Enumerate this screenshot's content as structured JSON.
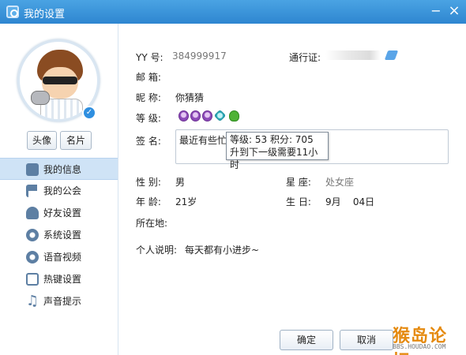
{
  "window": {
    "title": "我的设置"
  },
  "sidebar": {
    "avatar_button": "头像",
    "card_button": "名片",
    "items": [
      {
        "label": "我的信息",
        "icon": "profile-card-icon",
        "active": true
      },
      {
        "label": "我的公会",
        "icon": "flag-icon"
      },
      {
        "label": "好友设置",
        "icon": "friend-gear-icon"
      },
      {
        "label": "系统设置",
        "icon": "gear-icon"
      },
      {
        "label": "语音视频",
        "icon": "camera-icon"
      },
      {
        "label": "热键设置",
        "icon": "keyboard-icon"
      },
      {
        "label": "声音提示",
        "icon": "music-note-icon"
      }
    ]
  },
  "profile": {
    "yy_label": "YY 号:",
    "yy_value": "384999917",
    "passport_label": "通行证:",
    "email_label": "邮    箱:",
    "email_value": "",
    "nickname_label": "昵    称:",
    "nickname_value": "你猜猜",
    "level_label": "等    级:",
    "signature_label": "签    名:",
    "signature_value": "最近有些忙",
    "tooltip_line1": "等级: 53 积分: 705",
    "tooltip_line2": "升到下一级需要11小时",
    "gender_label": "性    别:",
    "gender_value": "男",
    "zodiac_label": "星    座:",
    "zodiac_value": "处女座",
    "age_label": "年    龄:",
    "age_value": "21岁",
    "birthday_label": "生    日:",
    "birthday_value": "9月    04日",
    "location_label": "所在地:",
    "location_value": "",
    "bio_label": "个人说明:",
    "bio_value": "每天都有小进步~"
  },
  "footer": {
    "ok_label": "确定",
    "cancel_label": "取消"
  },
  "watermark": {
    "main": "猴岛论坛",
    "sub": "BBS.HOUDAO.COM"
  },
  "colors": {
    "titlebar": "#2e86d0",
    "active_item": "#cfe3f6",
    "watermark": "#e58a10"
  }
}
